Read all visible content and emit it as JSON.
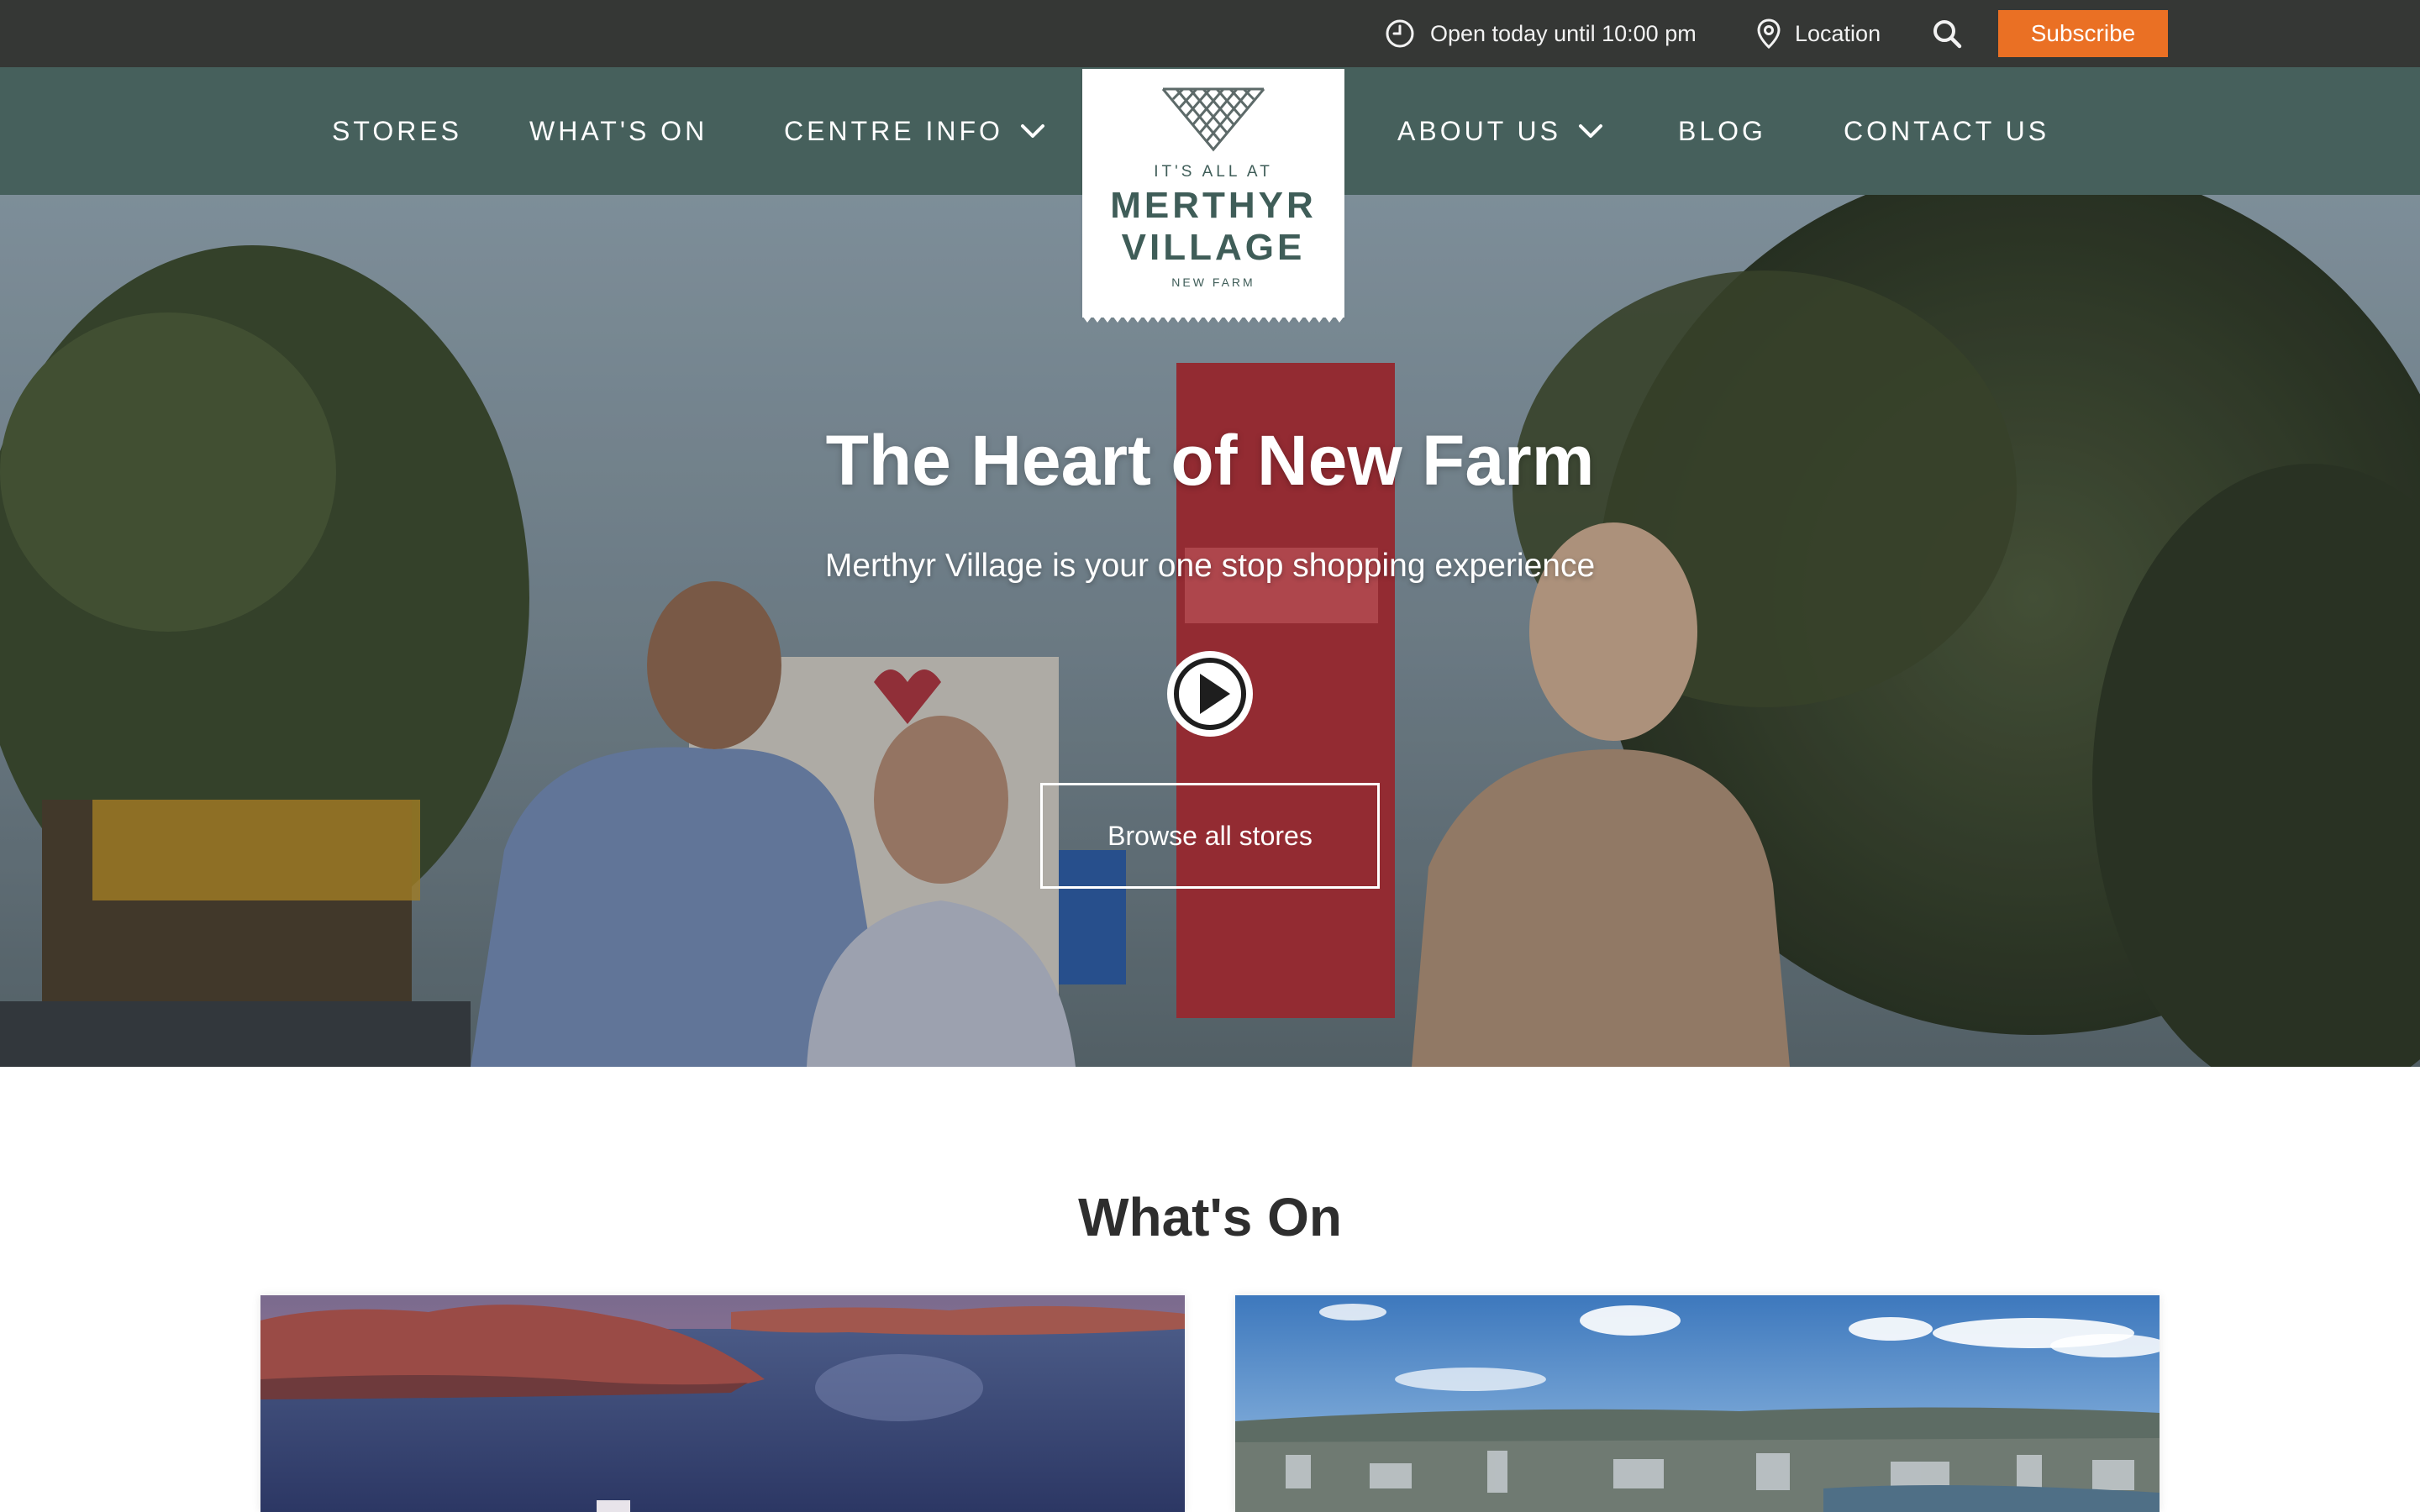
{
  "topbar": {
    "hours": "Open today until 10:00 pm",
    "location": "Location",
    "subscribe": "Subscribe",
    "icons": [
      "clock-icon",
      "map-pin-icon",
      "search-icon"
    ]
  },
  "nav": {
    "stores": "STORES",
    "whats_on": "WHAT'S ON",
    "centre_info": "CENTRE INFO",
    "about_us": "ABOUT US",
    "blog": "BLOG",
    "contact_us": "CONTACT US"
  },
  "logo": {
    "line1": "IT'S ALL AT",
    "line2": "MERTHYR",
    "line3": "VILLAGE",
    "line4": "NEW FARM"
  },
  "hero": {
    "title": "The Heart of New Farm",
    "subtitle": "Merthyr Village is your one stop shopping experience",
    "browse": "Browse all stores"
  },
  "whats_on": {
    "title": "What's On"
  },
  "colors": {
    "topbar": "#353735",
    "nav": "#46605c",
    "accent": "#ea7024",
    "logo_text": "#3f5d58"
  }
}
